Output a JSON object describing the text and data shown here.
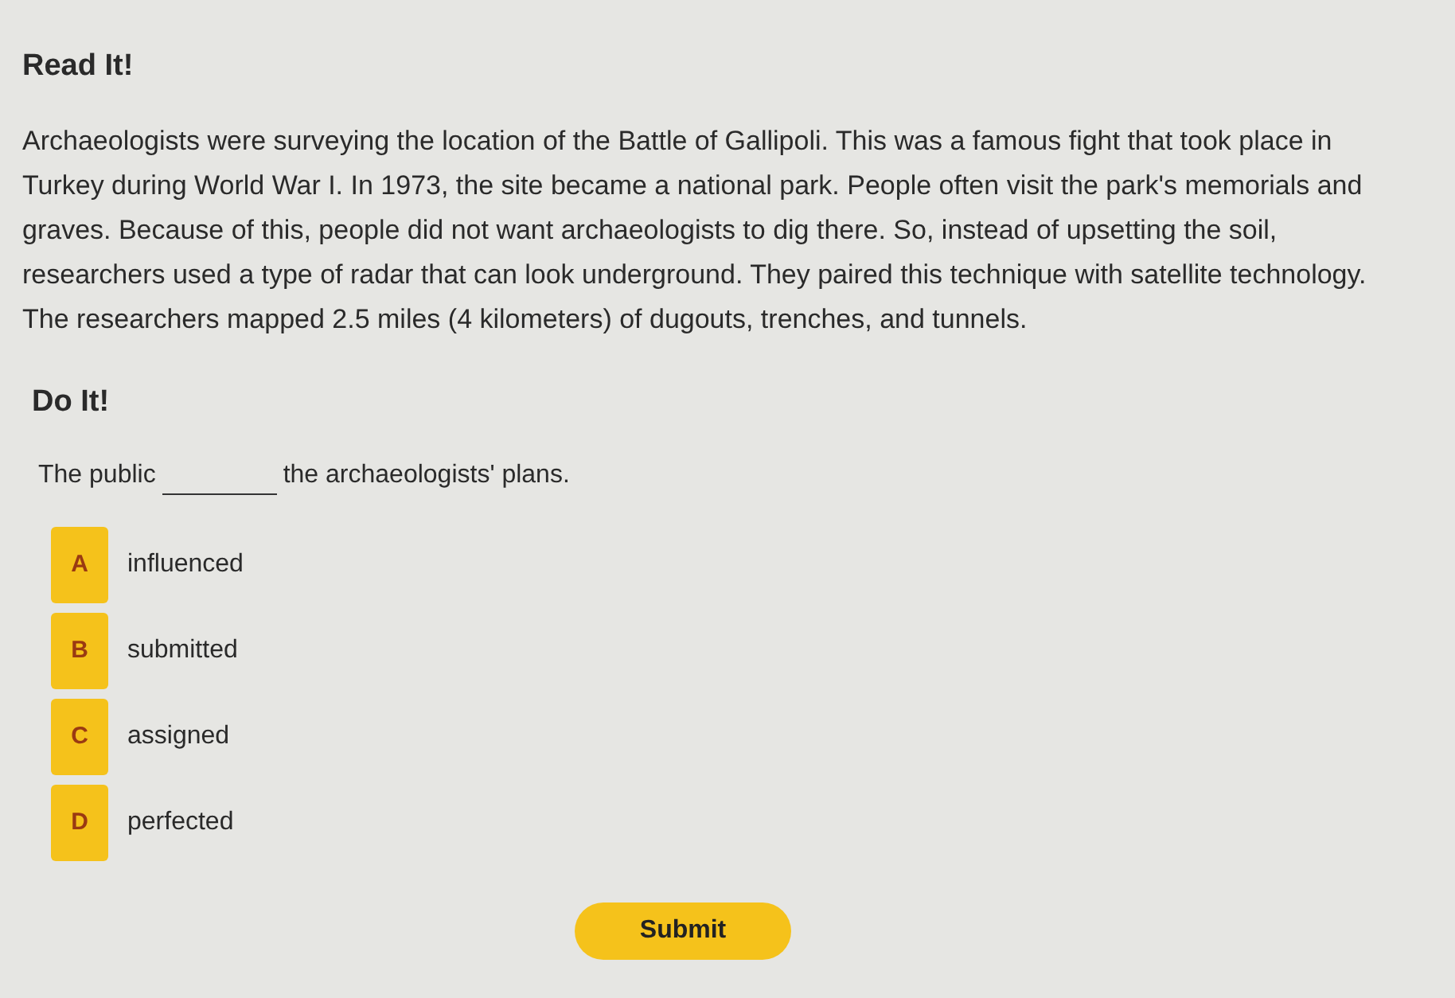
{
  "read_heading": "Read It!",
  "passage": "Archaeologists were surveying the location of the Battle of Gallipoli. This was a famous fight that took place in Turkey during World War I. In 1973, the site became a national park. People often visit the park's memorials and graves. Because of this, people did not want archaeologists to dig there. So, instead of upsetting the soil, researchers used a type of radar that can look underground. They paired this technique with satellite technology. The researchers mapped 2.5 miles (4 kilometers) of dugouts, trenches, and tunnels.",
  "do_heading": "Do It!",
  "question": {
    "before": "The public",
    "after": "the archaeologists' plans."
  },
  "options": [
    {
      "letter": "A",
      "text": "influenced",
      "selected": false
    },
    {
      "letter": "B",
      "text": "submitted",
      "selected": false
    },
    {
      "letter": "C",
      "text": "assigned",
      "selected": false
    },
    {
      "letter": "D",
      "text": "perfected",
      "selected": false
    }
  ],
  "submit": "Submit"
}
